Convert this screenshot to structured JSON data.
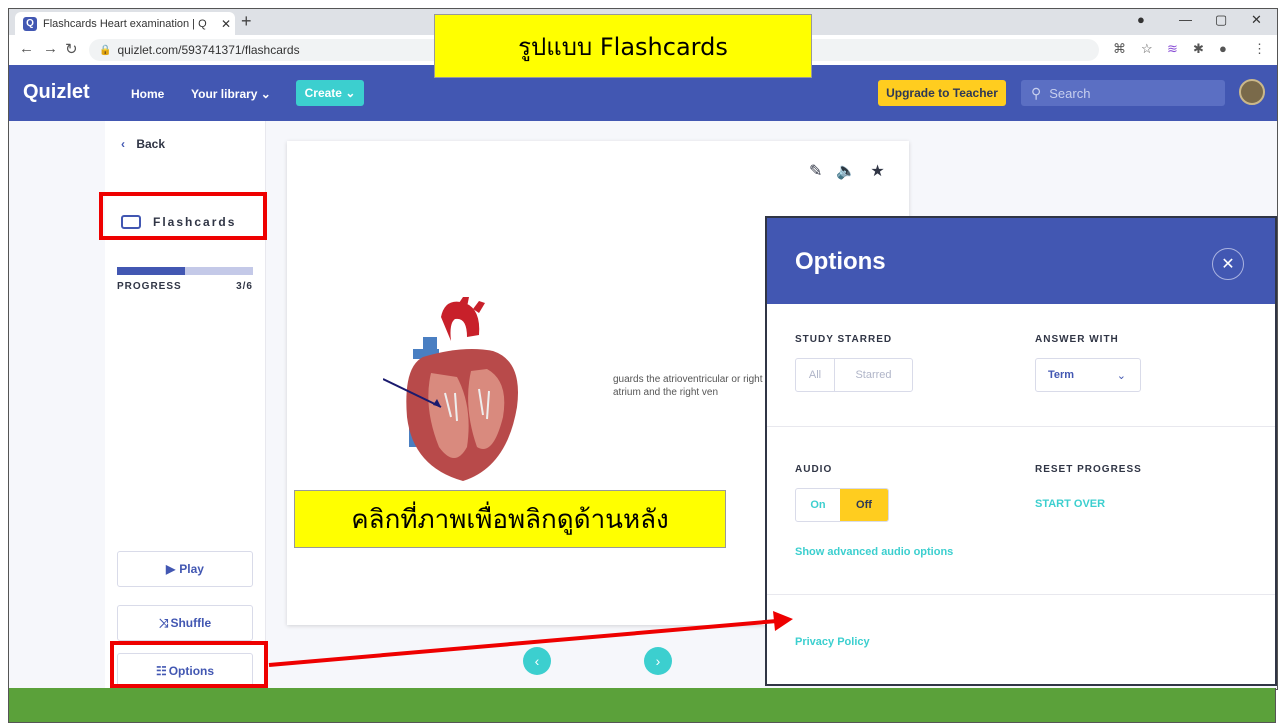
{
  "browser": {
    "tab_title": "Flashcards Heart examination | Q",
    "url": "quizlet.com/593741371/flashcards"
  },
  "header": {
    "logo": "Quizlet",
    "nav": [
      "Home",
      "Your library ⌄"
    ],
    "create_label": "Create ⌄",
    "upgrade_label": "Upgrade to Teacher",
    "search_placeholder": "Search"
  },
  "sidebar": {
    "back_label": "Back",
    "mode_label": "Flashcards",
    "progress_label": "PROGRESS",
    "progress_count": "3/6",
    "progress_fraction": 0.5,
    "play_label": "Play",
    "shuffle_label": "Shuffle",
    "options_label": "Options"
  },
  "card": {
    "definition": "guards the atrioventricular or right atrium and the right ven"
  },
  "options_panel": {
    "title": "Options",
    "study_starred_label": "STUDY STARRED",
    "study_all": "All",
    "study_starred": "Starred",
    "answer_with_label": "ANSWER WITH",
    "answer_with_value": "Term",
    "audio_label": "AUDIO",
    "audio_on": "On",
    "audio_off": "Off",
    "reset_label": "RESET PROGRESS",
    "start_over": "START OVER",
    "advanced_audio": "Show advanced audio options",
    "privacy": "Privacy Policy"
  },
  "annotations": {
    "title_callout": "รูปแบบ Flashcards",
    "flip_callout": "คลิกที่ภาพเพื่อพลิกดูด้านหลัง"
  },
  "colors": {
    "brand": "#4257b2",
    "accent": "#3ccfcf",
    "upgrade": "#ffcd1f",
    "highlight": "#ffff00",
    "annotation_red": "#ee0000",
    "footer_green": "#5ba13a"
  }
}
